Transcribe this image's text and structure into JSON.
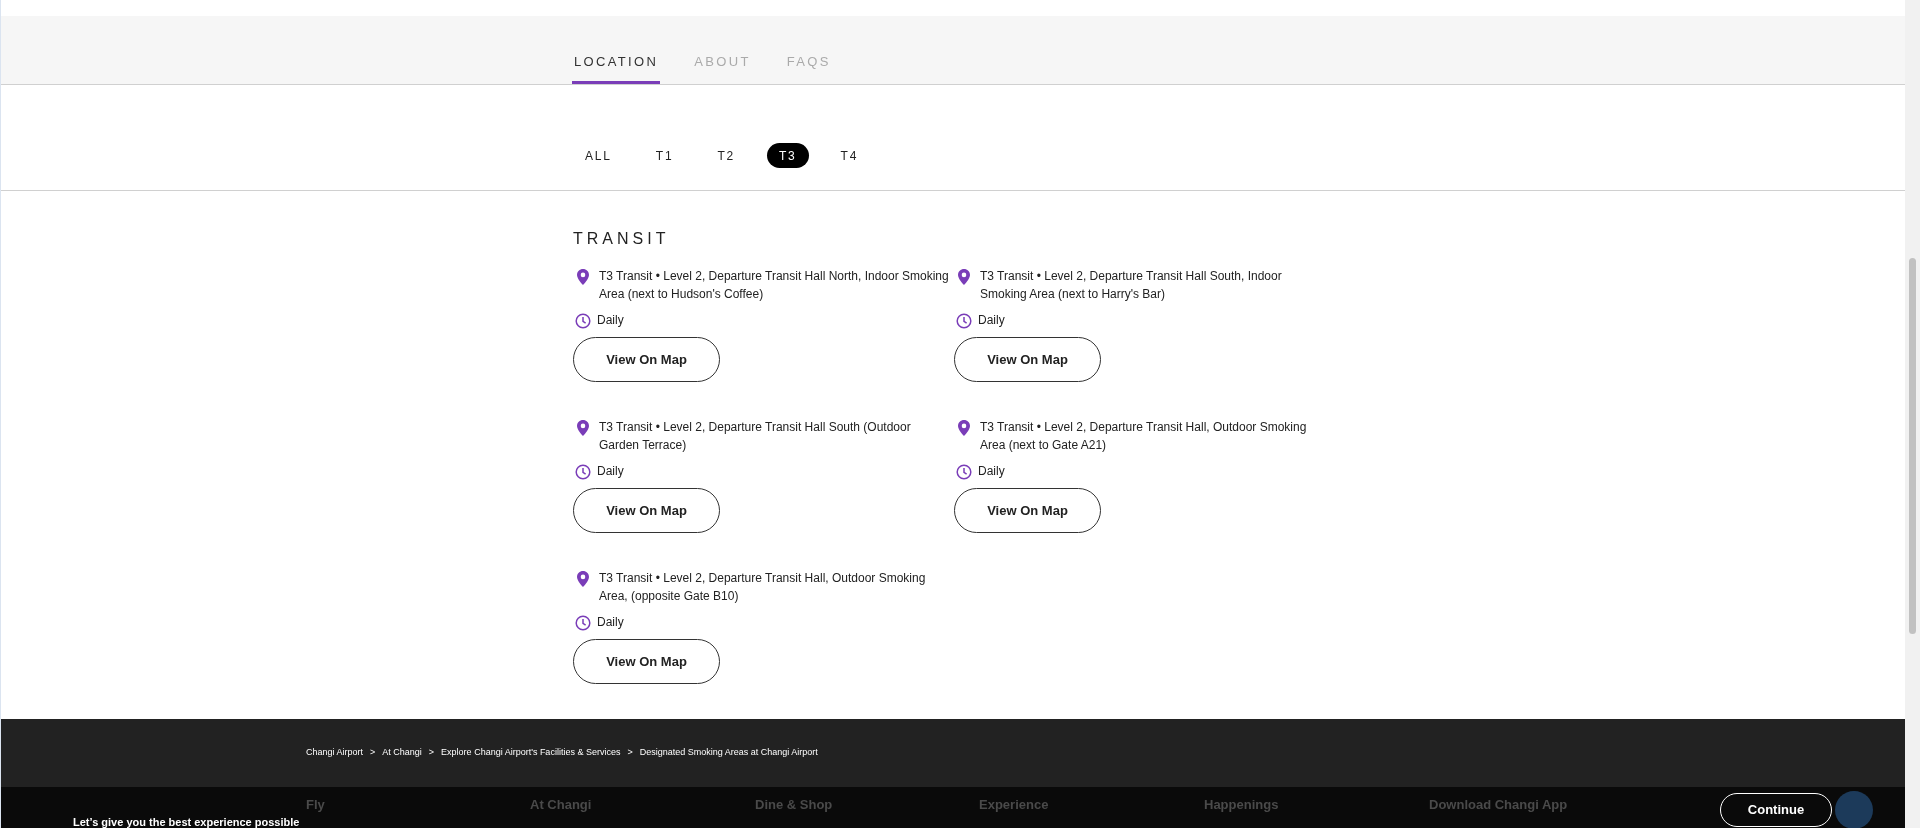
{
  "tabs": [
    {
      "label": "LOCATION",
      "selected": true
    },
    {
      "label": "ABOUT",
      "selected": false
    },
    {
      "label": "FAQS",
      "selected": false
    }
  ],
  "terminal_filters": [
    {
      "label": "ALL",
      "selected": false
    },
    {
      "label": "T1",
      "selected": false
    },
    {
      "label": "T2",
      "selected": false
    },
    {
      "label": "T3",
      "selected": true
    },
    {
      "label": "T4",
      "selected": false
    }
  ],
  "section_title": "TRANSIT",
  "locations": [
    {
      "address": "T3 Transit • Level 2, Departure Transit Hall North, Indoor Smoking Area (next to Hudson's Coffee)",
      "hours": "Daily",
      "button": "View On Map"
    },
    {
      "address": "T3 Transit • Level 2, Departure Transit Hall South, Indoor Smoking Area (next to Harry's Bar)",
      "hours": "Daily",
      "button": "View On Map"
    },
    {
      "address": "T3 Transit • Level 2, Departure Transit Hall South (Outdoor Garden Terrace)",
      "hours": "Daily",
      "button": "View On Map"
    },
    {
      "address": "T3 Transit • Level 2, Departure Transit Hall, Outdoor Smoking Area (next to Gate A21)",
      "hours": "Daily",
      "button": "View On Map"
    },
    {
      "address": "T3 Transit • Level 2, Departure Transit Hall, Outdoor Smoking Area, (opposite Gate B10)",
      "hours": "Daily",
      "button": "View On Map"
    }
  ],
  "breadcrumbs": [
    {
      "label": "Changi Airport",
      "separator": ">"
    },
    {
      "label": "At Changi",
      "separator": ">"
    },
    {
      "label": "Explore Changi Airport's Facilities & Services",
      "separator": ">"
    },
    {
      "label": "Designated Smoking Areas at Changi Airport"
    }
  ],
  "footer_headings": [
    "Fly",
    "At Changi",
    "Dine & Shop",
    "Experience",
    "Happenings",
    "Download Changi App"
  ],
  "cookie_banner": {
    "title": "Let’s give you the best experience possible",
    "button": "Continue"
  }
}
